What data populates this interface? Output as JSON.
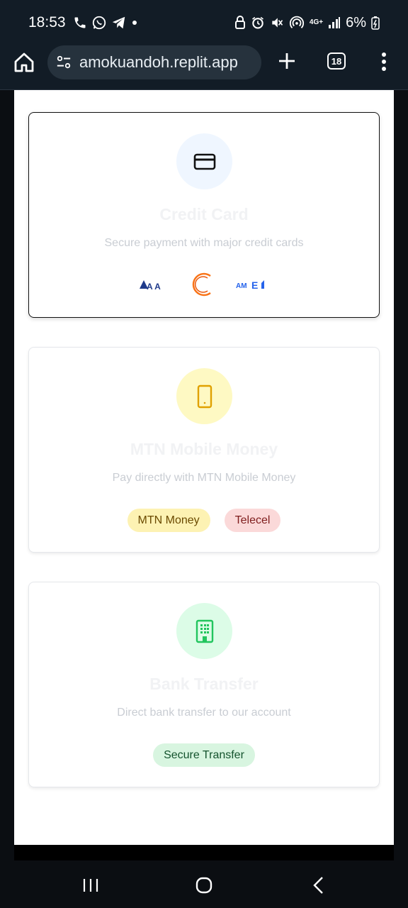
{
  "status_bar": {
    "time": "18:53",
    "battery": "6%",
    "network": "4G+",
    "icons": [
      "phone-icon",
      "whatsapp-icon",
      "telegram-icon",
      "dot-icon",
      "lock-icon",
      "alarm-icon",
      "mute-icon",
      "hotspot-icon",
      "signal-icon",
      "battery-icon"
    ]
  },
  "browser": {
    "url": "amokuandoh.replit.app",
    "tab_count": "18",
    "icons": [
      "home-icon",
      "site-settings-icon",
      "new-tab-icon",
      "tabs-icon",
      "more-options-icon"
    ]
  },
  "payment_methods": [
    {
      "title": "Credit Card",
      "description": "Secure payment with major credit cards",
      "icon": "credit-card-icon",
      "selected": true,
      "logos": [
        "visa-logo",
        "mastercard-logo",
        "amex-logo"
      ]
    },
    {
      "title": "MTN Mobile Money",
      "description": "Pay directly with MTN Mobile Money",
      "icon": "smartphone-icon",
      "selected": false,
      "badges": [
        "MTN Money",
        "Telecel"
      ]
    },
    {
      "title": "Bank Transfer",
      "description": "Direct bank transfer to our account",
      "icon": "building-icon",
      "selected": false,
      "badges": [
        "Secure Transfer"
      ]
    }
  ],
  "colors": {
    "status_bg": "#121c26",
    "url_pill_bg": "#26323d",
    "card_icon_bg": "#eff6ff",
    "mtn_icon_bg": "#fef9c3",
    "mtn_icon": "#e0a100",
    "bank_icon_bg": "#dcfce7",
    "bank_icon": "#22c55e",
    "mtn_badge_bg": "#fdf2b3",
    "telecel_badge_bg": "#fbd9d9",
    "secure_badge_bg": "#d8f5e0"
  },
  "nav_bar": {
    "icons": [
      "recent-apps-icon",
      "home-circle-icon",
      "back-icon"
    ]
  }
}
